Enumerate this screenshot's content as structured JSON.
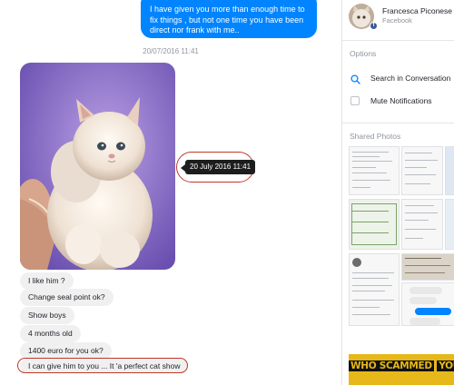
{
  "conversation": {
    "outgoing_message": "I have given you more than enough time to fix things , but not one time you have been direct nor frank with me..",
    "timestamp": "20/07/2016 11:41",
    "tooltip": "20 July 2016 11:41",
    "incoming_messages": [
      {
        "text": "I like him ?"
      },
      {
        "text": "Change seal point ok?"
      },
      {
        "text": "Show boys"
      },
      {
        "text": "4 months old"
      },
      {
        "text": "1400 euro for you ok?"
      },
      {
        "text": "I can give him to you ... It 'a perfect cat show"
      }
    ]
  },
  "sidebar": {
    "contact_name": "Francesca Piconese",
    "contact_platform": "Facebook",
    "options_title": "Options",
    "search_label": "Search in Conversation",
    "mute_label": "Mute Notifications",
    "shared_photos_title": "Shared Photos"
  },
  "watermark": {
    "text_a": "WHO SCAMMED",
    "text_b": "YOU.COM"
  },
  "colors": {
    "outgoing_bubble": "#0084ff",
    "incoming_bubble": "#f1f0f0",
    "highlight_ring": "#c0392b",
    "watermark_bg": "#e7b81a",
    "search_icon": "#0084ff"
  }
}
